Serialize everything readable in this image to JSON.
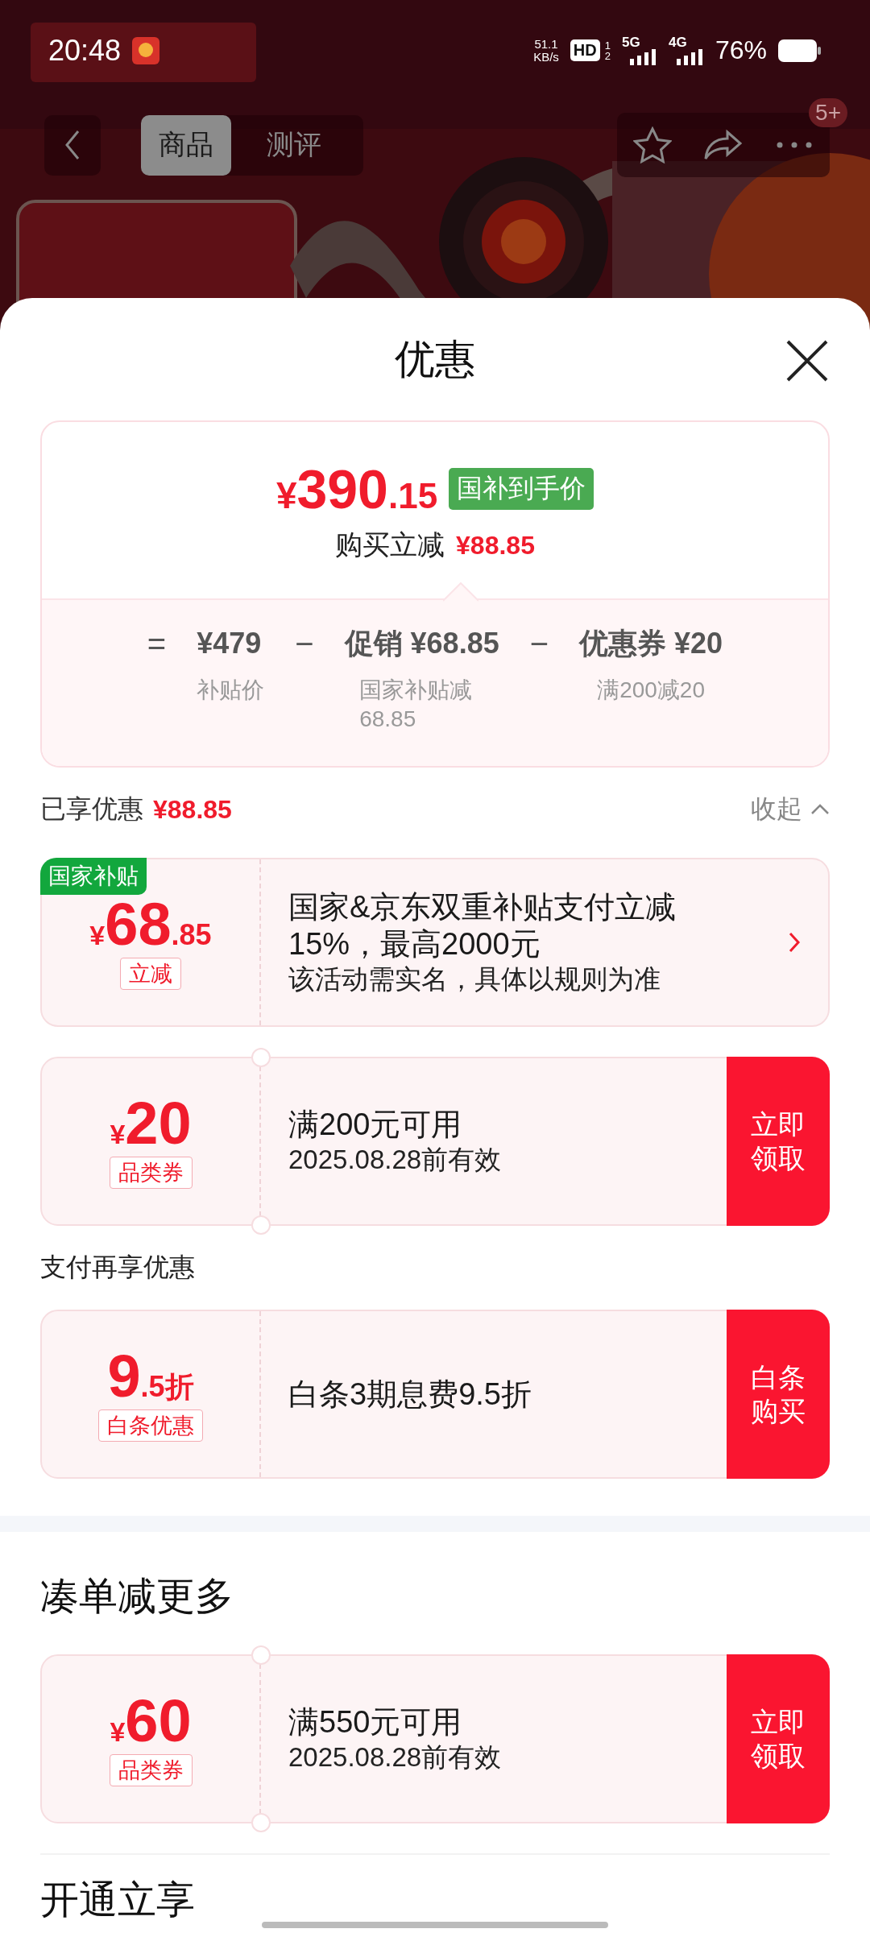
{
  "status_bar": {
    "time": "20:48",
    "net_speed": "51.1",
    "net_unit": "KB/s",
    "hd": "HD",
    "hd_slots": [
      "1",
      "2"
    ],
    "networks": [
      "5G",
      "4G"
    ],
    "battery": "76%"
  },
  "top_nav": {
    "tabs": [
      {
        "label": "商品",
        "selected": true
      },
      {
        "label": "测评",
        "selected": false
      }
    ],
    "badge": "5+"
  },
  "sheet": {
    "title": "优惠"
  },
  "price_card": {
    "currency": "¥",
    "integer": "390",
    "decimal": ".15",
    "tag": "国补到手价",
    "savings_label": "购买立减",
    "savings_value": "¥88.85",
    "breakdown": [
      {
        "kind": "op",
        "text": "="
      },
      {
        "kind": "term",
        "text": "¥479",
        "note": "补贴价"
      },
      {
        "kind": "op",
        "text": "−"
      },
      {
        "kind": "term",
        "text": "促销 ¥68.85",
        "note": "国家补贴减68.85"
      },
      {
        "kind": "op",
        "text": "−"
      },
      {
        "kind": "term",
        "text": "优惠券 ¥20",
        "note": "满200减20"
      }
    ]
  },
  "sections": [
    {
      "kind": "applied",
      "label": "已享优惠",
      "value": "¥88.85",
      "toggle": "收起",
      "expanded": true,
      "offers": [
        {
          "kind": "subsidy",
          "ribbon": "国家补贴",
          "currency": "¥",
          "integer": "68",
          "decimal": ".85",
          "tag": "立减",
          "title": "国家&京东双重补贴支付立减15%，最高2000元",
          "note": "该活动需实名，具体以规则为准"
        },
        {
          "kind": "coupon",
          "currency": "¥",
          "integer": "20",
          "tag": "品类券",
          "title": "满200元可用",
          "note": "2025.08.28前有效",
          "action": "立即领取"
        }
      ]
    },
    {
      "kind": "plain",
      "title": "支付再享优惠",
      "offers": [
        {
          "kind": "payment",
          "integer": "9",
          "decimal": ".5折",
          "tag": "白条优惠",
          "title": "白条3期息费9.5折",
          "action": "白条购买"
        }
      ]
    },
    {
      "kind": "group",
      "title": "凑单减更多",
      "offers": [
        {
          "kind": "coupon",
          "currency": "¥",
          "integer": "60",
          "tag": "品类券",
          "title": "满550元可用",
          "note": "2025.08.28前有效",
          "action": "立即领取"
        }
      ]
    },
    {
      "kind": "group",
      "title": "开通立享"
    }
  ]
}
